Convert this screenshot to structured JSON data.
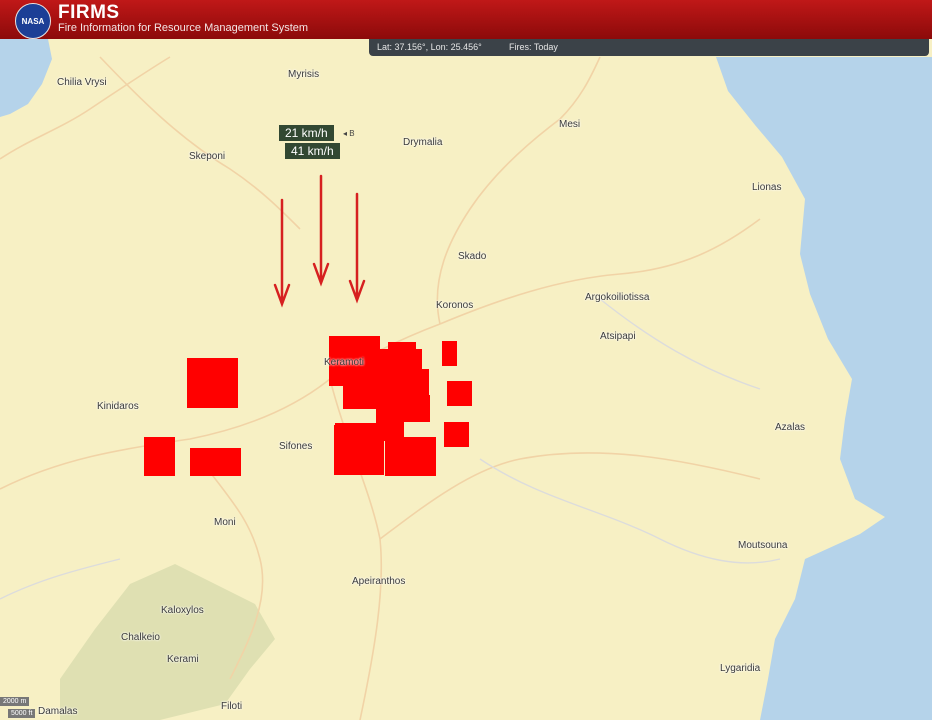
{
  "header": {
    "logo_text": "NASA",
    "title": "FIRMS",
    "subtitle": "Fire Information for Resource Management System"
  },
  "status": {
    "coords": "Lat: 37.156°, Lon: 25.456°",
    "fires": "Fires: Today"
  },
  "wind": {
    "speed1": "21 km/h",
    "speed2": "41 km/h",
    "marker": "◂ B"
  },
  "places": {
    "chilia_vrysi": "Chilia Vrysi",
    "myrisis": "Myrisis",
    "skeponi": "Skeponi",
    "drymalia": "Drymalia",
    "mesi": "Mesi",
    "lionas": "Lionas",
    "skado": "Skado",
    "koronos": "Koronos",
    "argokoiliotissa": "Argokoiliotissa",
    "atsipapi": "Atsipapi",
    "keramoti": "Keramoti",
    "kinidaros": "Kinidaros",
    "sifones": "Sifones",
    "azalas": "Azalas",
    "moni": "Moni",
    "moutsouna": "Moutsouna",
    "apeiranthos": "Apeiranthos",
    "kaloxylos": "Kaloxylos",
    "chalkeio": "Chalkeio",
    "kerami": "Kerami",
    "lygaridia": "Lygaridia",
    "filoti": "Filoti",
    "damalas": "Damalas"
  },
  "scale": {
    "metric": "2000 m",
    "imperial": "5000 ft"
  },
  "colors": {
    "header": "#a51010",
    "fire": "#ff0000",
    "sea": "#b5d3ea",
    "land": "#f7f0c4",
    "forest": "#dfe0b2",
    "wind_arrow": "#d62020"
  }
}
